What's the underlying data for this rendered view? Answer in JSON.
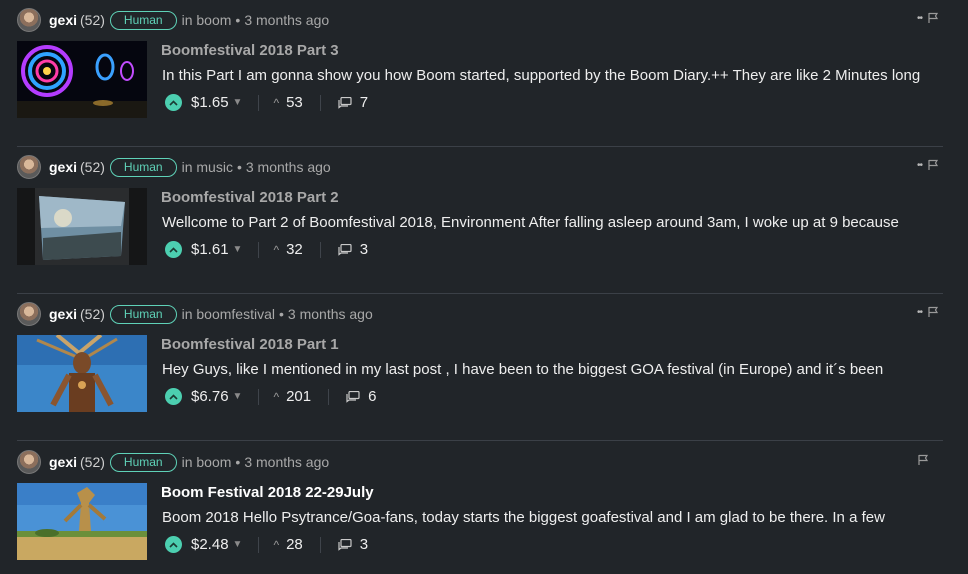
{
  "posts": [
    {
      "author": "gexi",
      "reputation": "(52)",
      "badge": "Human",
      "category": "in boom",
      "time": "3 months ago",
      "title": "Boomfestival 2018 Part 3",
      "summary": "In this Part I am gonna show you how Boom started, supported by the Boom Diary.++ They are like 2 Minutes long",
      "payout": "$1.65",
      "votes": "53",
      "comments": "7",
      "has_more_menu": true
    },
    {
      "author": "gexi",
      "reputation": "(52)",
      "badge": "Human",
      "category": "in music",
      "time": "3 months ago",
      "title": "Boomfestival 2018 Part 2",
      "summary": "Wellcome to Part 2 of Boomfestival 2018, Environment After falling asleep around 3am, I woke up at 9 because",
      "payout": "$1.61",
      "votes": "32",
      "comments": "3",
      "has_more_menu": true
    },
    {
      "author": "gexi",
      "reputation": "(52)",
      "badge": "Human",
      "category": "in boomfestival",
      "time": "3 months ago",
      "title": "Boomfestival 2018 Part 1",
      "summary": "Hey Guys, like I mentioned in my last post , I have been to the biggest GOA festival (in Europe) and it´s been",
      "payout": "$6.76",
      "votes": "201",
      "comments": "6",
      "has_more_menu": true
    },
    {
      "author": "gexi",
      "reputation": "(52)",
      "badge": "Human",
      "category": "in boom",
      "time": "3 months ago",
      "title": "Boom Festival 2018 22-29July",
      "summary": "Boom 2018 Hello Psytrance/Goa-fans, today starts the biggest goafestival and I am glad to be there. In a few",
      "payout": "$2.48",
      "votes": "28",
      "comments": "3",
      "has_more_menu": false
    }
  ],
  "colors": {
    "background": "#212529",
    "accent": "#4ccfb0",
    "divider": "#3b4047"
  },
  "icons": [
    "avatar",
    "more-icon",
    "flag-icon",
    "upvote-icon",
    "caret-down-icon",
    "votes-chevron-icon",
    "comments-icon"
  ]
}
